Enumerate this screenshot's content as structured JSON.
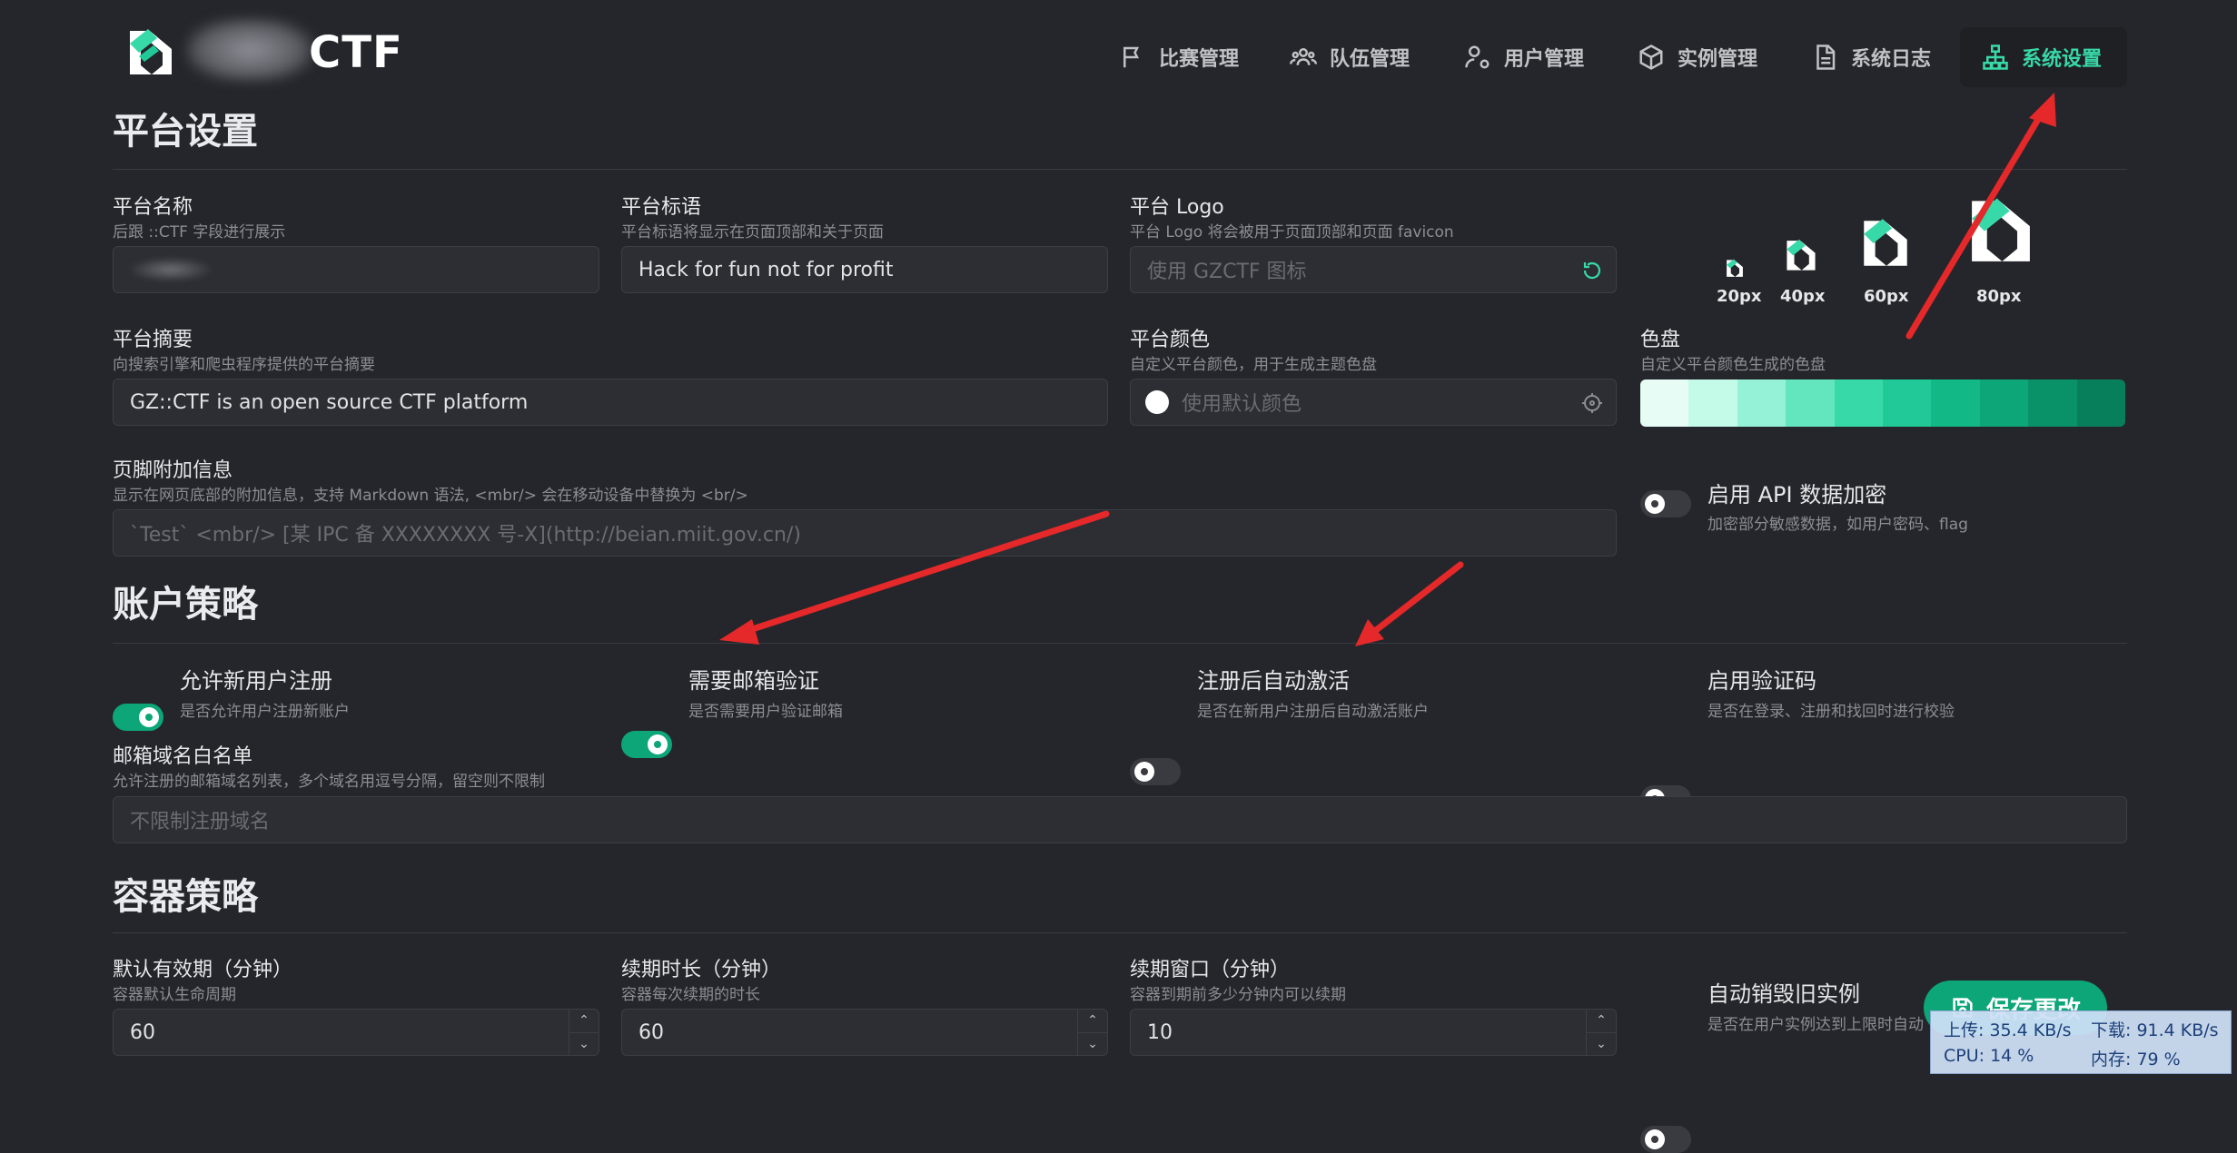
{
  "header": {
    "logo_text": "CTF",
    "nav": [
      {
        "label": "比赛管理",
        "icon": "flag-icon"
      },
      {
        "label": "队伍管理",
        "icon": "users-icon"
      },
      {
        "label": "用户管理",
        "icon": "user-cog-icon"
      },
      {
        "label": "实例管理",
        "icon": "box-icon"
      },
      {
        "label": "系统日志",
        "icon": "file-text-icon"
      },
      {
        "label": "系统设置",
        "icon": "sitemap-icon",
        "active": true
      }
    ]
  },
  "platform": {
    "title": "平台设置",
    "name": {
      "label": "平台名称",
      "desc": "后跟 ::CTF 字段进行展示",
      "value": ""
    },
    "slogan": {
      "label": "平台标语",
      "desc": "平台标语将显示在页面顶部和关于页面",
      "value": "Hack for fun not for profit"
    },
    "logo": {
      "label": "平台 Logo",
      "desc": "平台 Logo 将会被用于页面顶部和页面 favicon",
      "placeholder": "使用 GZCTF 图标",
      "sizes": [
        "20px",
        "40px",
        "60px",
        "80px"
      ]
    },
    "summary": {
      "label": "平台摘要",
      "desc": "向搜索引擎和爬虫程序提供的平台摘要",
      "value": "GZ::CTF is an open source CTF platform"
    },
    "color": {
      "label": "平台颜色",
      "desc": "自定义平台颜色，用于生成主题色盘",
      "placeholder": "使用默认颜色"
    },
    "palette": {
      "label": "色盘",
      "desc": "自定义平台颜色生成的色盘",
      "colors": [
        "#e6fcf5",
        "#c3fae8",
        "#96f2d7",
        "#63e6be",
        "#38d9a9",
        "#20c997",
        "#12b886",
        "#0ca678",
        "#099268",
        "#087f5b"
      ]
    },
    "footer": {
      "label": "页脚附加信息",
      "desc": "显示在网页底部的附加信息，支持 Markdown 语法, <mbr/> 会在移动设备中替换为 <br/>",
      "placeholder": "`Test` <mbr/> [某 IPC 备 XXXXXXXX 号-X](http://beian.miit.gov.cn/)"
    },
    "api_encrypt": {
      "label": "启用 API 数据加密",
      "desc": "加密部分敏感数据，如用户密码、flag",
      "on": false
    }
  },
  "account": {
    "title": "账户策略",
    "toggles": [
      {
        "label": "允许新用户注册",
        "desc": "是否允许用户注册新账户",
        "on": true
      },
      {
        "label": "需要邮箱验证",
        "desc": "是否需要用户验证邮箱",
        "on": true
      },
      {
        "label": "注册后自动激活",
        "desc": "是否在新用户注册后自动激活账户",
        "on": false
      },
      {
        "label": "启用验证码",
        "desc": "是否在登录、注册和找回时进行校验",
        "on": false
      }
    ],
    "whitelist": {
      "label": "邮箱域名白名单",
      "desc": "允许注册的邮箱域名列表，多个域名用逗号分隔，留空则不限制",
      "placeholder": "不限制注册域名"
    }
  },
  "container": {
    "title": "容器策略",
    "default_lifetime": {
      "label": "默认有效期（分钟）",
      "desc": "容器默认生命周期",
      "value": "60"
    },
    "extension": {
      "label": "续期时长（分钟）",
      "desc": "容器每次续期的时长",
      "value": "60"
    },
    "renew_window": {
      "label": "续期窗口（分钟）",
      "desc": "容器到期前多少分钟内可以续期",
      "value": "10"
    },
    "auto_destroy": {
      "label": "自动销毁旧实例",
      "desc": "是否在用户实例达到上限时自动",
      "on": false
    }
  },
  "save_button": "保存更改",
  "netmon": {
    "up": "上传: 35.4 KB/s",
    "down": "下载: 91.4 KB/s",
    "cpu": "CPU: 14 %",
    "mem": "内存: 79 %"
  }
}
